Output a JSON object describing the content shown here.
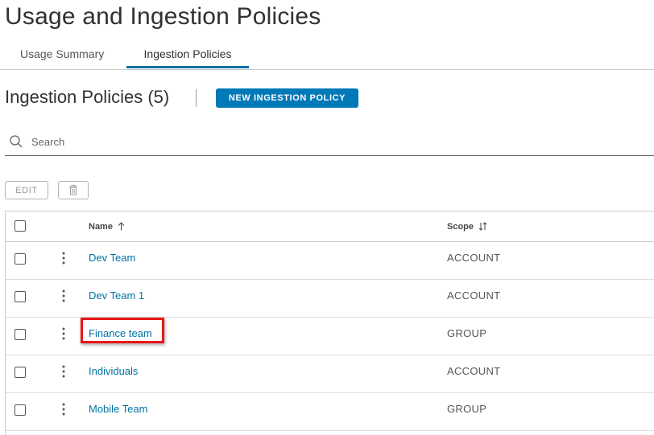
{
  "page": {
    "title": "Usage and Ingestion Policies",
    "tabs": [
      {
        "label": "Usage Summary",
        "active": false
      },
      {
        "label": "Ingestion Policies",
        "active": true
      }
    ]
  },
  "section": {
    "title": "Ingestion Policies (5)",
    "new_button_label": "NEW INGESTION POLICY"
  },
  "search": {
    "placeholder": "Search",
    "value": ""
  },
  "actions": {
    "edit_label": "EDIT",
    "delete_icon": "trash-icon"
  },
  "table": {
    "columns": [
      {
        "label": "Name",
        "sort": "ascending"
      },
      {
        "label": "Scope",
        "sort": "unsorted"
      }
    ],
    "rows": [
      {
        "name": "Dev Team",
        "scope": "ACCOUNT",
        "checked": false
      },
      {
        "name": "Dev Team 1",
        "scope": "ACCOUNT",
        "checked": false
      },
      {
        "name": "Finance team",
        "scope": "GROUP",
        "checked": false,
        "highlighted": true
      },
      {
        "name": "Individuals",
        "scope": "ACCOUNT",
        "checked": false
      },
      {
        "name": "Mobile Team",
        "scope": "GROUP",
        "checked": false
      }
    ]
  },
  "colors": {
    "accent": "#0079b8",
    "link": "#0072a3",
    "highlight": "#e81616"
  }
}
